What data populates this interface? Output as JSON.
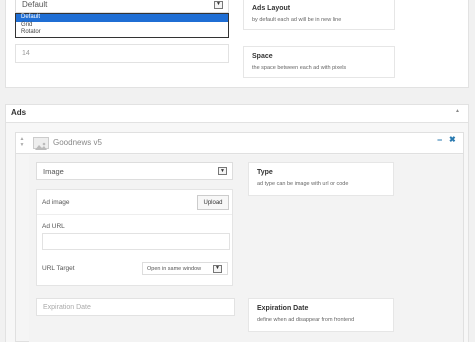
{
  "layout": {
    "select_value": "Default",
    "options": [
      "Default",
      "Grid",
      "Rotator"
    ],
    "ads_layout_title": "Ads Layout",
    "ads_layout_desc": "by default each ad will be in new line",
    "space_value": "14",
    "space_title": "Space",
    "space_desc": "the space between each ad with pixels"
  },
  "ads": {
    "section_title": "Ads",
    "item": {
      "name": "Goodnews v5",
      "type_value": "Image",
      "type_title": "Type",
      "type_desc": "ad type can be image with url or code",
      "ad_image_label": "Ad image",
      "upload_label": "Upload",
      "ad_url_label": "Ad URL",
      "ad_url_value": "",
      "url_target_label": "URL Target",
      "url_target_value": "Open in same window",
      "expiration_placeholder": "Expiration Date",
      "expiration_title": "Expiration Date",
      "expiration_desc": "define when ad disappear from frontend"
    }
  },
  "colors": {
    "accent": "#2a7ab0",
    "selection": "#1f6ed4"
  }
}
